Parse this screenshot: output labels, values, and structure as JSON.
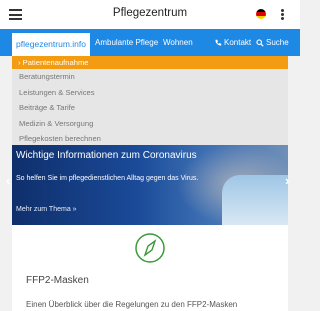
{
  "header": {
    "title": "Pflegezentrum",
    "flag_colors": [
      "#000000",
      "#dd0000",
      "#ffce00"
    ]
  },
  "nav": {
    "home": "pflegezentrum.info",
    "links": [
      "Ambulante Pflege",
      "Wohnen"
    ],
    "contact": "Kontakt",
    "search": "Suche",
    "color": "#1e88e5"
  },
  "dropdown": {
    "active": "Patientenaufnahme",
    "items": [
      "Beratungstermin",
      "Leistungen & Services",
      "Beiträge & Tarife",
      "Medizin & Versorgung",
      "Pflegekosten berechnen"
    ],
    "accent": "#f39c12"
  },
  "hero": {
    "title": "Wichtige Informationen zum Coronavirus",
    "text": "So helfen Sie im pflegedienstlichen Alltag gegen das Virus.",
    "more": "Mehr zum Thema »",
    "prev": "‹",
    "next": "›"
  },
  "card": {
    "icon": "compass-icon",
    "title": "FFP2-Masken",
    "text": "Einen Überblick über die Regelungen zu den FFP2-Masken"
  }
}
